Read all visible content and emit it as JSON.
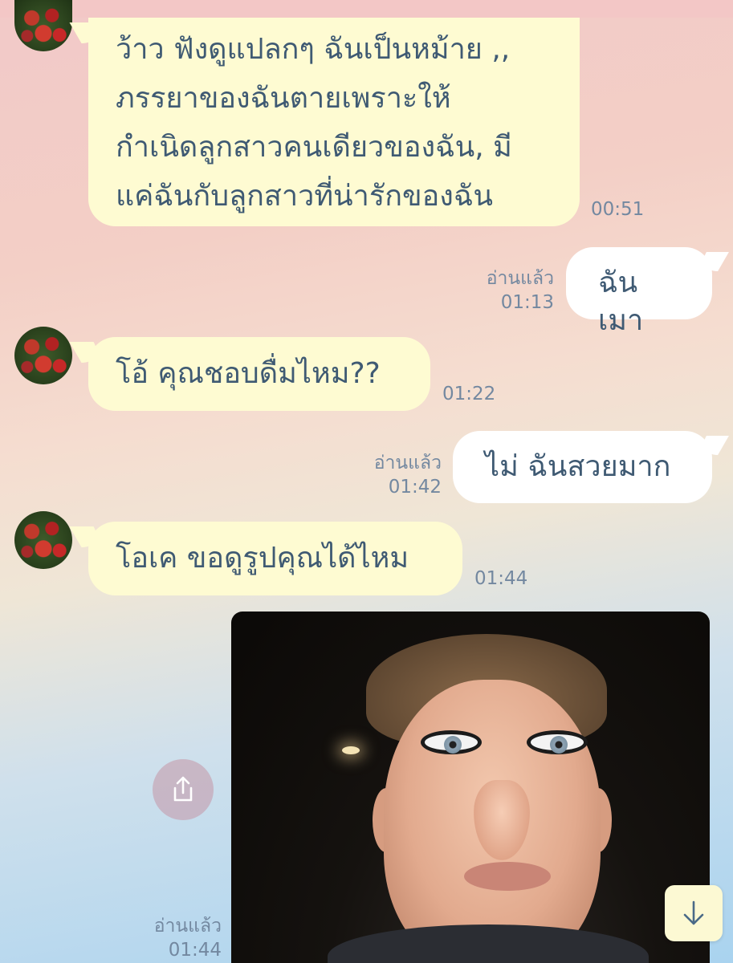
{
  "messages": [
    {
      "sender": "other",
      "lines": [
        "ว้าว ฟังดูแปลกๆ ฉันเป็นหม้าย ,,",
        "ภรรยาของฉันตายเพราะให้",
        "กำเนิดลูกสาวคนเดียวของฉัน, มี",
        "แค่ฉันกับลูกสาวที่น่ารักของฉัน"
      ],
      "time": "00:51"
    },
    {
      "sender": "me",
      "text": "ฉันเมา",
      "read": "อ่านแล้ว",
      "time": "01:13"
    },
    {
      "sender": "other",
      "text": "โอ้ คุณชอบดื่มไหม??",
      "time": "01:22"
    },
    {
      "sender": "me",
      "text": "ไม่ ฉันสวยมาก",
      "read": "อ่านแล้ว",
      "time": "01:42"
    },
    {
      "sender": "other",
      "text": "โอเค ขอดูรูปคุณได้ไหม",
      "time": "01:44"
    },
    {
      "sender": "me",
      "type": "image",
      "read": "อ่านแล้ว",
      "time": "01:44"
    }
  ],
  "icons": {
    "share": "share-icon",
    "scroll_down": "arrow-down-icon"
  },
  "colors": {
    "incoming_bubble": "#fefbd2",
    "outgoing_bubble": "#ffffff",
    "text": "#3f5a73",
    "meta": "#7388a0"
  }
}
